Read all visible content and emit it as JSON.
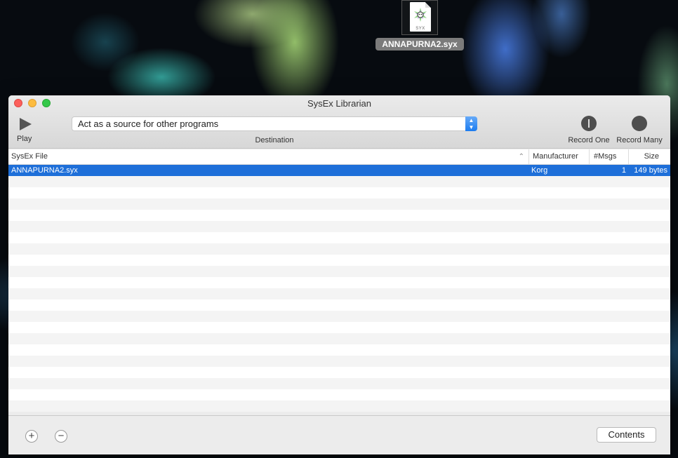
{
  "desktop": {
    "file_icon": {
      "name": "ANNAPURNA2.syx",
      "badge_text": "SYX",
      "icon": "sysex-file-icon"
    }
  },
  "window": {
    "title": "SysEx Librarian",
    "toolbar": {
      "play_label": "Play",
      "destination_value": "Act as a source for other programs",
      "destination_label": "Destination",
      "record_one_label": "Record One",
      "record_many_label": "Record Many"
    },
    "table": {
      "columns": [
        "SysEx File",
        "Manufacturer",
        "#Msgs",
        "Size"
      ],
      "rows": [
        {
          "file": "ANNAPURNA2.syx",
          "manufacturer": "Korg",
          "msgs": "1",
          "size": "149 bytes",
          "selected": true
        }
      ],
      "empty_row_count": 21
    },
    "footer": {
      "add_symbol": "+",
      "remove_symbol": "−",
      "contents_label": "Contents"
    }
  },
  "colors": {
    "selection": "#1e6fd9",
    "close": "#fc605c",
    "minimize": "#fdbc40",
    "zoom": "#34c84a",
    "popup_arrow": "#1c7cf0"
  }
}
